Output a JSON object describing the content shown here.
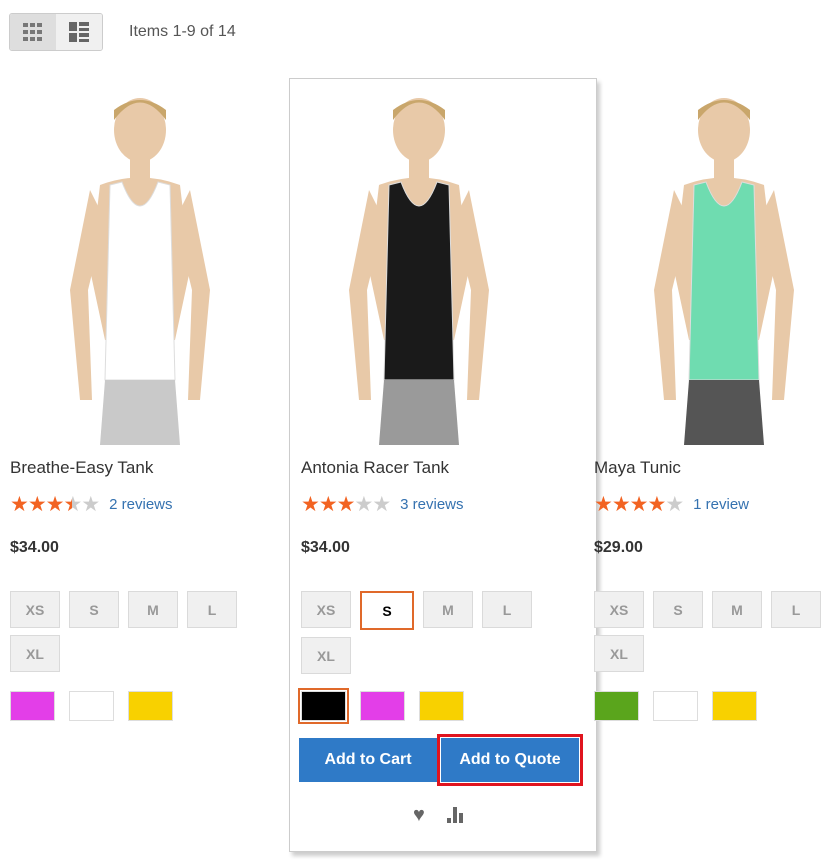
{
  "toolbar": {
    "modes": [
      {
        "icon": "grid-icon",
        "active": true
      },
      {
        "icon": "list-icon",
        "active": false
      }
    ],
    "amount": "Items 1-9 of 14"
  },
  "products": [
    {
      "name": "Breathe-Easy Tank",
      "rating": 3.5,
      "reviews": "2 reviews",
      "price": "$34.00",
      "sizes": [
        "XS",
        "S",
        "M",
        "L",
        "XL"
      ],
      "selected_size": null,
      "colors": [
        "#e33ee8",
        "#ffffff",
        "#f8d100"
      ],
      "selected_color": null,
      "top": "#ffffff",
      "bottom": "#c9c9c9"
    },
    {
      "name": "Antonia Racer Tank",
      "rating": 3,
      "reviews": "3 reviews",
      "price": "$34.00",
      "sizes": [
        "XS",
        "S",
        "M",
        "L",
        "XL"
      ],
      "selected_size": "S",
      "colors": [
        "#000000",
        "#e33ee8",
        "#f8d100"
      ],
      "selected_color": "#000000",
      "top": "#1a1a1a",
      "bottom": "#9a9a9a",
      "actions": {
        "add_to_cart": "Add to Cart",
        "add_to_quote": "Add to Quote"
      }
    },
    {
      "name": "Maya Tunic",
      "rating": 4,
      "reviews": "1 review",
      "price": "$29.00",
      "sizes": [
        "XS",
        "S",
        "M",
        "L",
        "XL"
      ],
      "selected_size": null,
      "colors": [
        "#5aa51c",
        "#ffffff",
        "#f8d100"
      ],
      "selected_color": null,
      "top": "#6fdcb0",
      "bottom": "#555555"
    }
  ],
  "accent": "#2f7ac7",
  "highlight": "#e0141e"
}
